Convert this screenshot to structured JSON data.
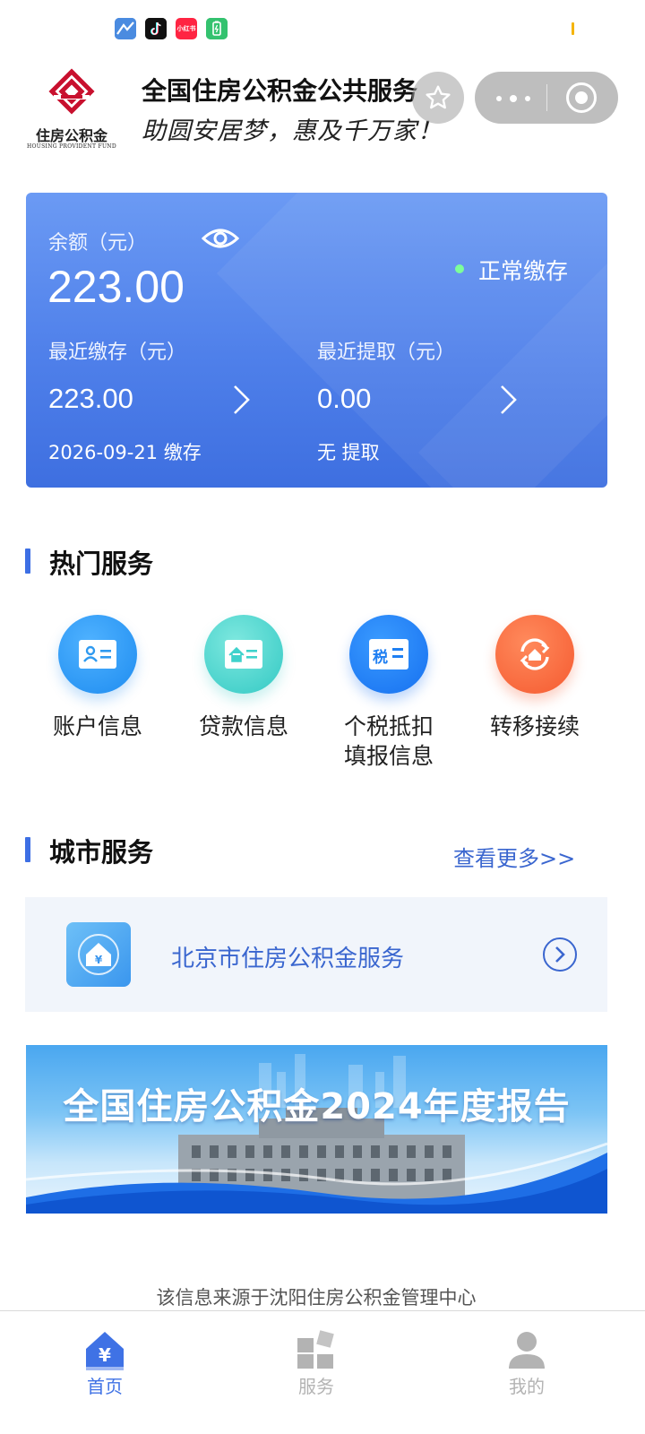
{
  "status_bar": {
    "icons": [
      "maps-app-icon",
      "douyin-app-icon",
      "xiaohongshu-app-icon",
      "battery-app-icon"
    ],
    "app_icon_texts": [
      "小红书"
    ]
  },
  "header": {
    "logo_cn": "住房公积金",
    "logo_en": "HOUSING PROVIDENT FUND",
    "title": "全国住房公积金公共服务",
    "slogan": "助圆安居梦，惠及千万家！"
  },
  "balance_card": {
    "balance_label": "余额（元）",
    "balance_value": "223.00",
    "status_text": "正常缴存",
    "recent_deposit_label": "最近缴存（元）",
    "recent_deposit_value": "223.00",
    "recent_deposit_note": "2026-09-21 缴存",
    "recent_withdraw_label": "最近提取（元）",
    "recent_withdraw_value": "0.00",
    "recent_withdraw_note": "无 提取"
  },
  "hot_services": {
    "title": "热门服务",
    "items": [
      {
        "label": "账户信息",
        "icon": "account-card-icon",
        "color": "#2f9af0"
      },
      {
        "label": "贷款信息",
        "icon": "loan-card-icon",
        "color": "#3fd2cc"
      },
      {
        "label": "个税抵扣\n填报信息",
        "icon": "tax-card-icon",
        "badge": "税",
        "color": "#1f7ff2"
      },
      {
        "label": "转移接续",
        "icon": "transfer-house-icon",
        "color": "#f96a3c"
      }
    ]
  },
  "city_services": {
    "title": "城市服务",
    "more_label": "查看更多>>",
    "item_label": "北京市住房公积金服务",
    "icon_glyph": "¥"
  },
  "banner": {
    "title": "全国住房公积金2024年度报告"
  },
  "footer": {
    "source_note": "该信息来源于沈阳住房公积金管理中心"
  },
  "bottom_nav": {
    "items": [
      {
        "label": "首页",
        "icon": "home-yuan-icon",
        "active": true,
        "glyph": "¥"
      },
      {
        "label": "服务",
        "icon": "grid-service-icon",
        "active": false
      },
      {
        "label": "我的",
        "icon": "user-profile-icon",
        "active": false
      }
    ],
    "active_color": "#3f72e5",
    "inactive_color": "#b3b3b3"
  }
}
